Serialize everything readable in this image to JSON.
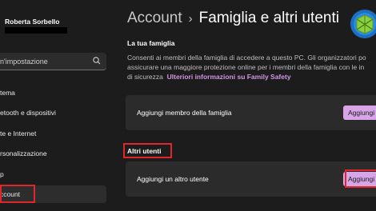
{
  "user": {
    "name": "Roberta Sorbello"
  },
  "search": {
    "placeholder": "n'impostazione"
  },
  "nav": {
    "items": [
      {
        "label": "tema"
      },
      {
        "label": "etooth e dispositivi"
      },
      {
        "label": "te e Internet"
      },
      {
        "label": "rsonalizzazione"
      },
      {
        "label": "p"
      },
      {
        "label": "ccount"
      }
    ]
  },
  "breadcrumb": {
    "parent": "Account",
    "separator": "›",
    "current": "Famiglia e altri utenti"
  },
  "family": {
    "title": "La tua famiglia",
    "desc_line1": "Consenti ai membri della famiglia di accedere a questo PC. Gli organizzatori po",
    "desc_line2": "assicurare una maggiore protezione online per i membri della famiglia con le in",
    "desc_line3_prefix": "di sicurezza",
    "desc_link": "Ulteriori informazioni su Family Safety",
    "add_member_label": "Aggiungi membro della famiglia",
    "add_member_button": "Aggiungi"
  },
  "others": {
    "title": "Altri utenti",
    "add_user_label": "Aggiungi un altro utente",
    "add_user_button": "Aggiungi"
  },
  "colors": {
    "accent": "#d8a6e8",
    "link": "#d196e6",
    "highlight": "#e0262b"
  }
}
